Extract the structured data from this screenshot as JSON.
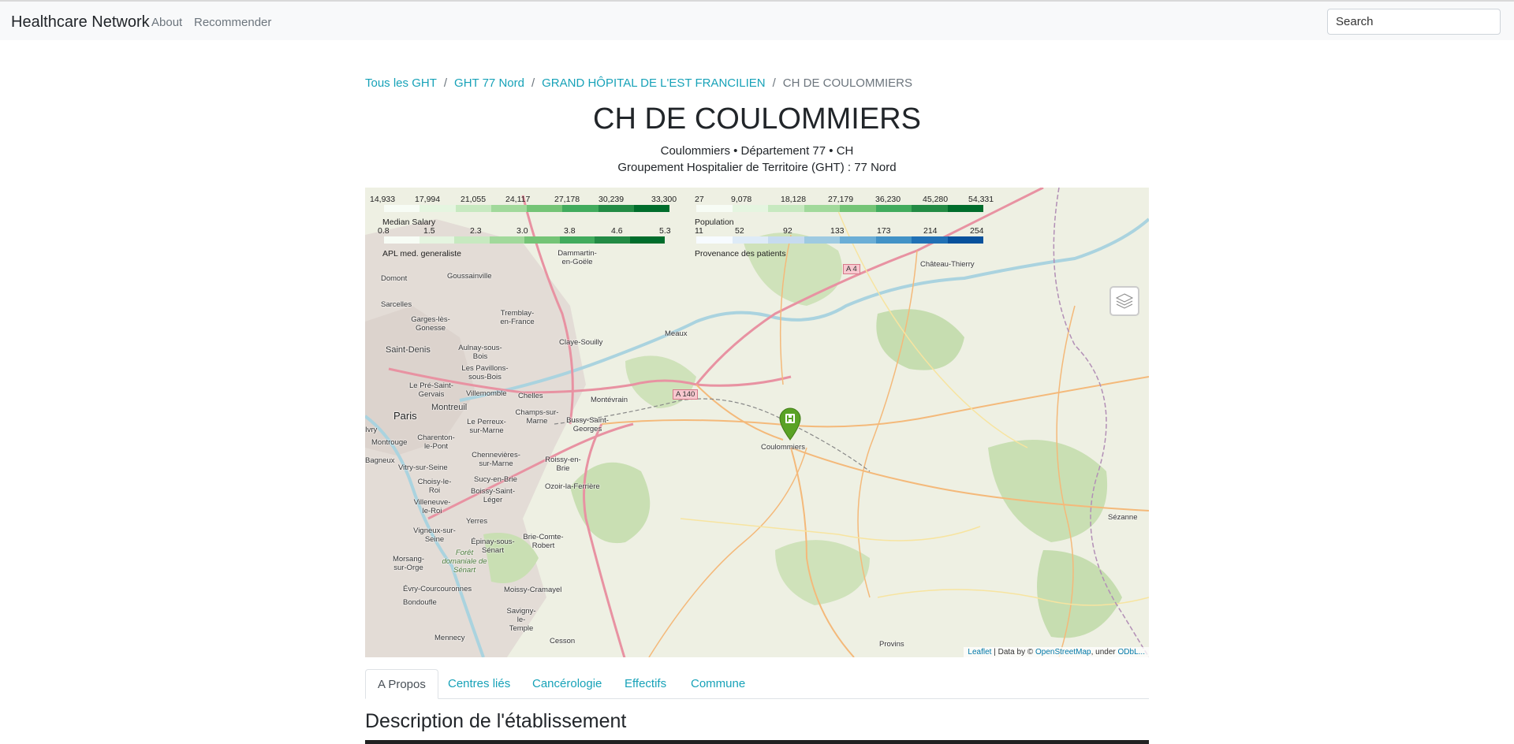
{
  "navbar": {
    "brand": "Healthcare Network",
    "links": [
      "About",
      "Recommender"
    ],
    "search_placeholder": "Search"
  },
  "breadcrumb": [
    "Tous les GHT",
    "GHT 77 Nord",
    "GRAND HÔPITAL DE L'EST FRANCILIEN",
    "CH DE COULOMMIERS"
  ],
  "page": {
    "title": "CH DE COULOMMIERS",
    "subtitle1": "Coulommiers • Département 77 • CH",
    "subtitle2": "Groupement Hospitalier de Territoire (GHT) : 77 Nord"
  },
  "map": {
    "legends": [
      {
        "title": "Median Salary",
        "ticks": [
          "14,933",
          "17,994",
          "21,055",
          "24,117",
          "27,178",
          "30,239",
          "33,300"
        ],
        "colors": [
          "#f0f9e8",
          "#ccebc5",
          "#a8ddb5",
          "#7bccc4",
          "#43a2ca",
          "#0868ac"
        ],
        "scheme": "green"
      },
      {
        "title": "Population",
        "ticks": [
          "27",
          "9,078",
          "18,128",
          "27,179",
          "36,230",
          "45,280",
          "54,331"
        ],
        "scheme": "green"
      },
      {
        "title": "APL med. generaliste",
        "ticks": [
          "0.8",
          "1.5",
          "2.3",
          "3.0",
          "3.8",
          "4.6",
          "5.3"
        ],
        "scheme": "green"
      },
      {
        "title": "Provenance des patients",
        "ticks": [
          "11",
          "52",
          "92",
          "133",
          "173",
          "214",
          "254"
        ],
        "scheme": "blue"
      }
    ],
    "places": [
      {
        "name": "Paris",
        "size": "big"
      },
      {
        "name": "Saint-Denis",
        "size": "mid"
      },
      {
        "name": "Montreuil",
        "size": "mid"
      },
      {
        "name": "Meaux",
        "size": "small"
      },
      {
        "name": "Coulommiers",
        "size": "small"
      },
      {
        "name": "Château-Thierry",
        "size": "small"
      },
      {
        "name": "Sézanne",
        "size": "small"
      },
      {
        "name": "Provins",
        "size": "small"
      },
      {
        "name": "Dammartin-en-Goële",
        "size": "small"
      },
      {
        "name": "Goussainville",
        "size": "small"
      },
      {
        "name": "Domont",
        "size": "small"
      },
      {
        "name": "Sarcelles",
        "size": "small"
      },
      {
        "name": "Garges-lès-Gonesse",
        "size": "small"
      },
      {
        "name": "Tremblay-en-France",
        "size": "small"
      },
      {
        "name": "Claye-Souilly",
        "size": "small"
      },
      {
        "name": "Aulnay-sous-Bois",
        "size": "small"
      },
      {
        "name": "Les Pavillons-sous-Bois",
        "size": "small"
      },
      {
        "name": "Le Pré-Saint-Gervais",
        "size": "small"
      },
      {
        "name": "Villemomble",
        "size": "small"
      },
      {
        "name": "Chelles",
        "size": "small"
      },
      {
        "name": "Montévrain",
        "size": "small"
      },
      {
        "name": "Le Perreux-sur-Marne",
        "size": "small"
      },
      {
        "name": "Champs-sur-Marne",
        "size": "small"
      },
      {
        "name": "Bussy-Saint-Georges",
        "size": "small"
      },
      {
        "name": "Charenton-le-Pont",
        "size": "small"
      },
      {
        "name": "Montrouge",
        "size": "small"
      },
      {
        "name": "Chennevières-sur-Marne",
        "size": "small"
      },
      {
        "name": "Roissy-en-Brie",
        "size": "small"
      },
      {
        "name": "Vitry-sur-Seine",
        "size": "small"
      },
      {
        "name": "Choisy-le-Roi",
        "size": "small"
      },
      {
        "name": "Sucy-en-Brie",
        "size": "small"
      },
      {
        "name": "Ozoir-la-Ferrière",
        "size": "small"
      },
      {
        "name": "Boissy-Saint-Léger",
        "size": "small"
      },
      {
        "name": "Villeneuve-le-Roi",
        "size": "small"
      },
      {
        "name": "Yerres",
        "size": "small"
      },
      {
        "name": "Vigneux-sur-Seine",
        "size": "small"
      },
      {
        "name": "Épinay-sous-Sénart",
        "size": "small"
      },
      {
        "name": "Brie-Comte-Robert",
        "size": "small"
      },
      {
        "name": "Forêt domaniale de Sénart",
        "size": "small"
      },
      {
        "name": "Morsang-sur-Orge",
        "size": "small"
      },
      {
        "name": "Évry-Courcouronnes",
        "size": "small"
      },
      {
        "name": "Moissy-Cramayel",
        "size": "small"
      },
      {
        "name": "Bondoufle",
        "size": "small"
      },
      {
        "name": "Savigny-le-Temple",
        "size": "small"
      },
      {
        "name": "Mennecy",
        "size": "small"
      },
      {
        "name": "Cesson",
        "size": "small"
      },
      {
        "name": "Bagneux",
        "size": "small"
      },
      {
        "name": "Ivry",
        "size": "small"
      },
      {
        "name": "A 140",
        "size": "road"
      },
      {
        "name": "A 4",
        "size": "road"
      }
    ],
    "attribution": {
      "leaflet": "Leaflet",
      "text1": " | Data by © ",
      "osm": "OpenStreetMap",
      "text2": ", under ",
      "odbl": "ODbL..."
    }
  },
  "tabs": [
    "A Propos",
    "Centres liés",
    "Cancérologie",
    "Effectifs",
    "Commune"
  ],
  "active_tab": "A Propos",
  "section_title": "Description de l'établissement"
}
